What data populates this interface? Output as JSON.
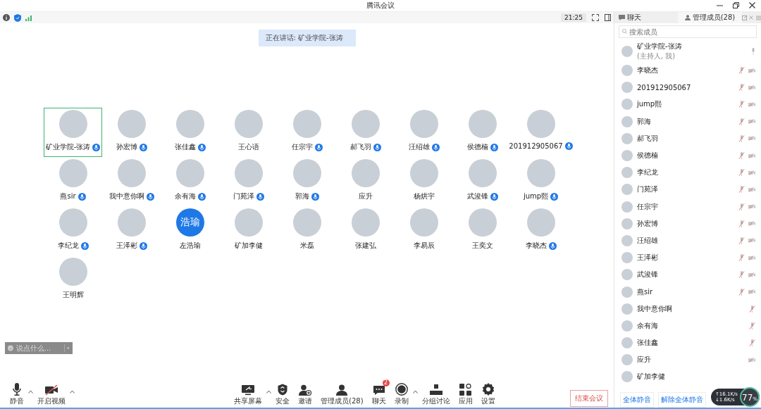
{
  "window": {
    "title": "腾讯会议"
  },
  "top_bar": {
    "time": "21:25"
  },
  "speaking_banner": "正在讲话: 矿业学院-张涛",
  "participants": [
    {
      "name": "矿业学院-张涛",
      "mic": true,
      "selected": true
    },
    {
      "name": "孙宏博",
      "mic": true,
      "selected": false
    },
    {
      "name": "张佳鑫",
      "mic": true,
      "selected": false
    },
    {
      "name": "王心语",
      "mic": false,
      "selected": false
    },
    {
      "name": "任宗宇",
      "mic": true,
      "selected": false
    },
    {
      "name": "郝飞羽",
      "mic": true,
      "selected": false
    },
    {
      "name": "汪绍雄",
      "mic": true,
      "selected": false
    },
    {
      "name": "侯德楠",
      "mic": true,
      "selected": false
    },
    {
      "name": "201912905067",
      "mic": true,
      "selected": false
    },
    {
      "name": "燕sir",
      "mic": true,
      "selected": false
    },
    {
      "name": "我中意你啊",
      "mic": true,
      "selected": false
    },
    {
      "name": "余有海",
      "mic": true,
      "selected": false
    },
    {
      "name": "门苑泽",
      "mic": true,
      "selected": false
    },
    {
      "name": "郭海",
      "mic": true,
      "selected": false
    },
    {
      "name": "应升",
      "mic": false,
      "selected": false
    },
    {
      "name": "杨烘宇",
      "mic": false,
      "selected": false
    },
    {
      "name": "武浚锋",
      "mic": true,
      "selected": false
    },
    {
      "name": "jump熙",
      "mic": true,
      "selected": false
    },
    {
      "name": "李纪龙",
      "mic": true,
      "selected": false
    },
    {
      "name": "王泽彬",
      "mic": true,
      "selected": false
    },
    {
      "name": "左浩瑜",
      "mic": false,
      "selected": false,
      "avatar_text": "浩瑜"
    },
    {
      "name": "矿加李健",
      "mic": false,
      "selected": false
    },
    {
      "name": "米磊",
      "mic": false,
      "selected": false
    },
    {
      "name": "张建弘",
      "mic": false,
      "selected": false
    },
    {
      "name": "李易辰",
      "mic": false,
      "selected": false
    },
    {
      "name": "王奕文",
      "mic": false,
      "selected": false
    },
    {
      "name": "李晓杰",
      "mic": true,
      "selected": false
    },
    {
      "name": "王明辉",
      "mic": false,
      "selected": false
    }
  ],
  "chat_input": {
    "placeholder": "说点什么..."
  },
  "bottom_toolbar": {
    "left": [
      {
        "label": "静音",
        "kind": "mic",
        "caret": true
      },
      {
        "label": "开启视频",
        "kind": "video",
        "caret": true
      }
    ],
    "center": [
      {
        "label": "共享屏幕",
        "kind": "share",
        "caret": true
      },
      {
        "label": "安全",
        "kind": "security",
        "caret": false
      },
      {
        "label": "邀请",
        "kind": "invite",
        "caret": false
      },
      {
        "label": "管理成员(28)",
        "kind": "members",
        "caret": false
      },
      {
        "label": "聊天",
        "kind": "chat",
        "caret": false,
        "badge": "2"
      },
      {
        "label": "录制",
        "kind": "record",
        "caret": true
      },
      {
        "label": "分组讨论",
        "kind": "breakout",
        "caret": false
      },
      {
        "label": "应用",
        "kind": "apps",
        "caret": false
      },
      {
        "label": "设置",
        "kind": "settings",
        "caret": false
      }
    ],
    "end_button": "结束会议"
  },
  "panel": {
    "tabs": [
      {
        "label": "聊天",
        "selected": false
      },
      {
        "label": "管理成员(28)",
        "selected": true
      }
    ],
    "search": {
      "placeholder": "搜索成员"
    },
    "host": {
      "name": "矿业学院-张涛",
      "role": "(主持人, 我)"
    },
    "members": [
      {
        "name": "李晓杰",
        "mic_muted": true,
        "camera_off": true
      },
      {
        "name": "201912905067",
        "mic_muted": true,
        "camera_off": true
      },
      {
        "name": "jump熙",
        "mic_muted": true,
        "camera_off": true
      },
      {
        "name": "郭海",
        "mic_muted": true,
        "camera_off": true
      },
      {
        "name": "郝飞羽",
        "mic_muted": true,
        "camera_off": true
      },
      {
        "name": "侯德楠",
        "mic_muted": true,
        "camera_off": true
      },
      {
        "name": "李纪龙",
        "mic_muted": true,
        "camera_off": true
      },
      {
        "name": "门苑泽",
        "mic_muted": true,
        "camera_off": true
      },
      {
        "name": "任宗宇",
        "mic_muted": true,
        "camera_off": true
      },
      {
        "name": "孙宏博",
        "mic_muted": true,
        "camera_off": true
      },
      {
        "name": "汪绍雄",
        "mic_muted": true,
        "camera_off": true
      },
      {
        "name": "王泽彬",
        "mic_muted": true,
        "camera_off": true
      },
      {
        "name": "武浚锋",
        "mic_muted": true,
        "camera_off": true
      },
      {
        "name": "燕sir",
        "mic_muted": true,
        "camera_off": true
      },
      {
        "name": "我中意你啊",
        "mic_muted": true,
        "camera_off": false
      },
      {
        "name": "余有海",
        "mic_muted": true,
        "camera_off": false
      },
      {
        "name": "张佳鑫",
        "mic_muted": true,
        "camera_off": false
      },
      {
        "name": "应升",
        "mic_muted": false,
        "camera_off": true
      },
      {
        "name": "矿加李健",
        "mic_muted": false,
        "camera_off": false
      }
    ],
    "buttons": [
      "全体静音",
      "解除全体静音"
    ]
  },
  "network_widget": {
    "upload": "↑16.1K/s",
    "download": "↓1.6K/s",
    "usage": "77",
    "unit": "%"
  }
}
